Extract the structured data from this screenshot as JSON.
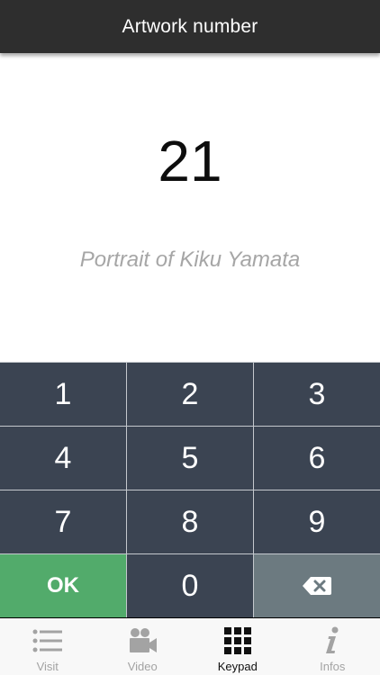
{
  "header": {
    "title": "Artwork number"
  },
  "display": {
    "number": "21",
    "artwork_title": "Portrait of Kiku Yamata"
  },
  "keypad": {
    "keys": [
      "1",
      "2",
      "3",
      "4",
      "5",
      "6",
      "7",
      "8",
      "9"
    ],
    "ok_label": "OK",
    "zero_label": "0",
    "delete_icon": "backspace-icon"
  },
  "tabbar": {
    "tabs": [
      {
        "label": "Visit",
        "icon": "list-icon",
        "active": false
      },
      {
        "label": "Video",
        "icon": "video-camera-icon",
        "active": false
      },
      {
        "label": "Keypad",
        "icon": "keypad-grid-icon",
        "active": true
      },
      {
        "label": "Infos",
        "icon": "info-icon",
        "active": false
      }
    ]
  },
  "colors": {
    "header_bg": "#2e2e2e",
    "key_bg": "#3b4452",
    "ok_bg": "#52ab6b",
    "delete_bg": "#6c7a80",
    "inactive_tab": "#a3a3a3",
    "active_tab": "#111111"
  }
}
